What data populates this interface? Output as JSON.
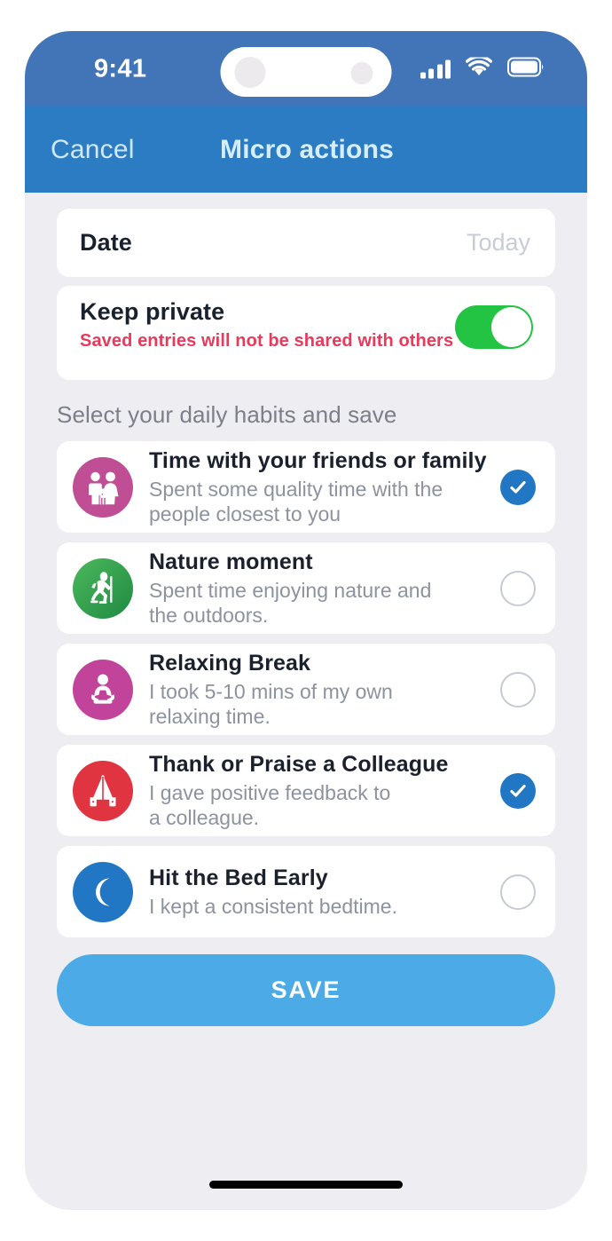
{
  "status_bar": {
    "time": "9:41",
    "icons": [
      "cellular-signal-icon",
      "wifi-icon",
      "battery-icon"
    ]
  },
  "nav_bar": {
    "cancel_label": "Cancel",
    "title": "Micro actions"
  },
  "date_row": {
    "label": "Date",
    "value": "Today"
  },
  "privacy_row": {
    "label": "Keep private",
    "note": "Saved entries will not be shared with others",
    "toggle_on": true
  },
  "section": {
    "heading": "Select your daily habits and save"
  },
  "habits": [
    {
      "title": "Time with your friends or family",
      "description": "Spent some quality time with the\npeople closest to you",
      "icon": "family-icon",
      "icon_color": "#bf4e94",
      "selected": true
    },
    {
      "title": "Nature moment",
      "description": "Spent time enjoying nature and\nthe outdoors.",
      "icon": "hiker-icon",
      "icon_color": "#2f9e4f",
      "selected": false
    },
    {
      "title": "Relaxing Break",
      "description": "I took 5-10 mins of my own\nrelaxing time.",
      "icon": "meditation-icon",
      "icon_color": "#c2449a",
      "selected": false
    },
    {
      "title": "Thank or Praise a Colleague",
      "description": "I gave positive feedback to\na colleague.",
      "icon": "praying-hands-icon",
      "icon_color": "#e03540",
      "selected": true
    },
    {
      "title": "Hit the Bed Early",
      "description": "I kept a consistent bedtime.",
      "icon": "moon-icon",
      "icon_color": "#2277c4",
      "selected": false
    }
  ],
  "save_button": {
    "label": "SAVE"
  },
  "colors": {
    "status_bar_bg": "#4274b8",
    "nav_bar_bg": "#2c7cc4",
    "screen_bg": "#eeedf2",
    "card_bg": "#ffffff",
    "accent_blue": "#2277c4",
    "save_blue": "#4cabe6",
    "toggle_green": "#23c344",
    "warning_red": "#e83a5b"
  }
}
